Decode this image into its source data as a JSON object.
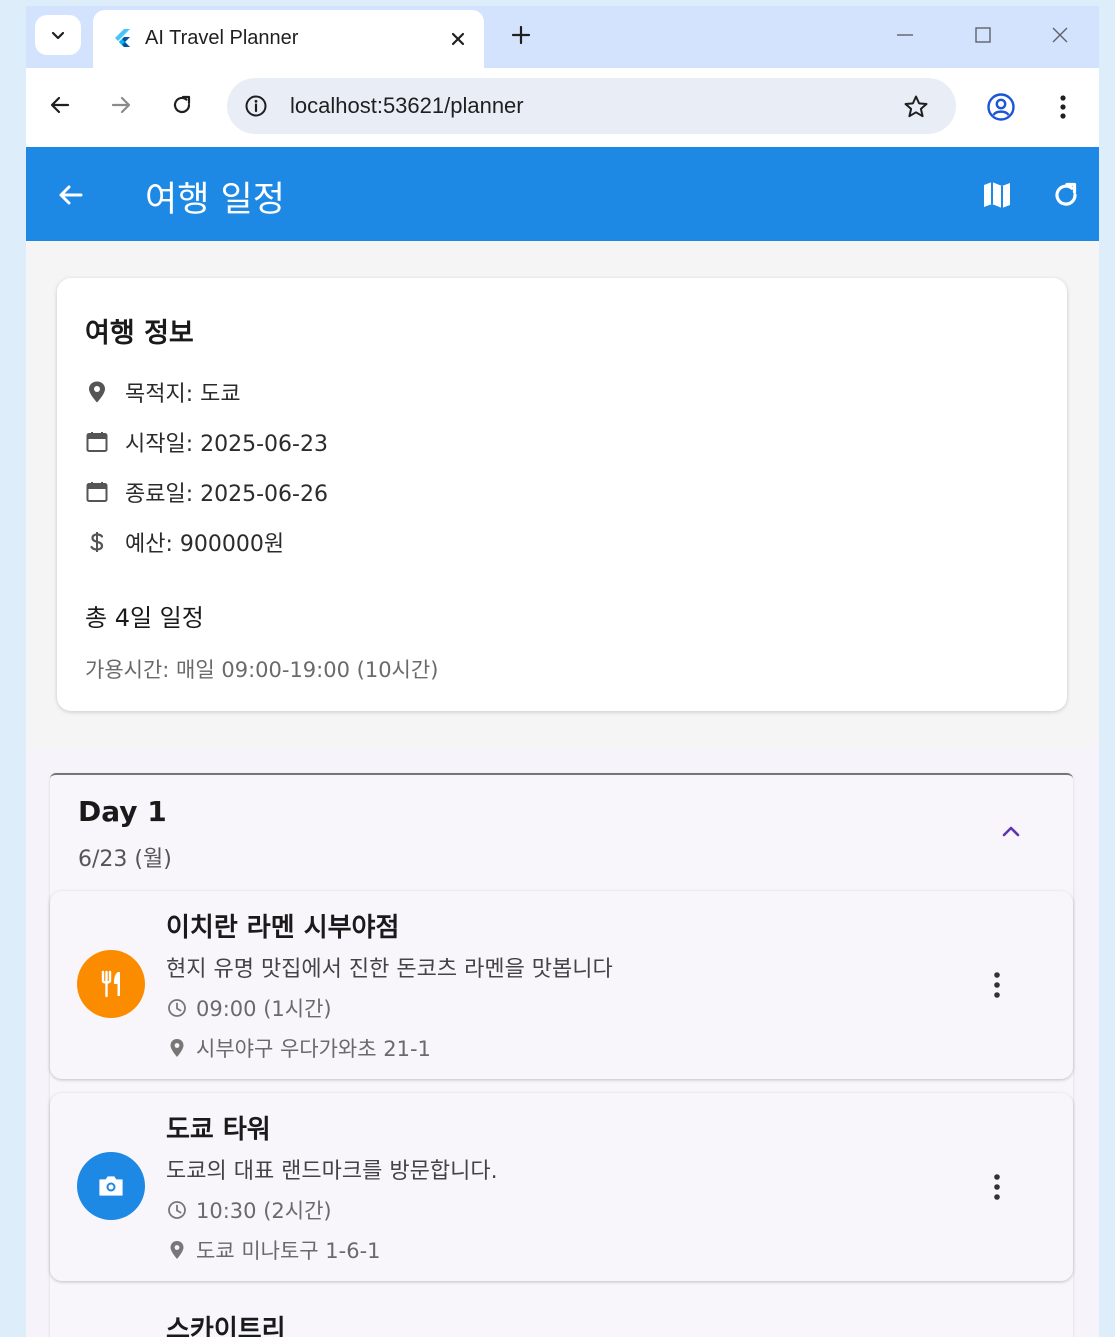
{
  "browser": {
    "tab_title": "AI Travel Planner",
    "url": "localhost:53621/planner"
  },
  "appbar": {
    "title": "여행 일정"
  },
  "trip_info": {
    "title": "여행 정보",
    "destination": "목적지: 도쿄",
    "start_date": "시작일: 2025-06-23",
    "end_date": "종료일: 2025-06-26",
    "budget": "예산: 900000원",
    "total_days": "총 4일 일정",
    "available_time": "가용시간: 매일 09:00-19:00 (10시간)"
  },
  "day": {
    "title": "Day 1",
    "date": "6/23 (월)",
    "activities": [
      {
        "name": "이치란 라멘 시부야점",
        "description": "현지 유명 맛집에서 진한 돈코츠 라멘을 맛봅니다",
        "time": "09:00 (1시간)",
        "address": "시부야구 우다가와초 21-1",
        "icon": "restaurant-icon",
        "color": "#fb8c00"
      },
      {
        "name": "도쿄 타워",
        "description": "도쿄의 대표 랜드마크를 방문합니다.",
        "time": "10:30 (2시간)",
        "address": "도쿄 미나토구 1-6-1",
        "icon": "camera-icon",
        "color": "#1e88e5"
      },
      {
        "name": "스카이트리"
      }
    ]
  },
  "colors": {
    "appbar": "#1e88e5",
    "accent_collapse": "#5e35b1",
    "restaurant": "#fb8c00",
    "sightseeing": "#1e88e5"
  }
}
